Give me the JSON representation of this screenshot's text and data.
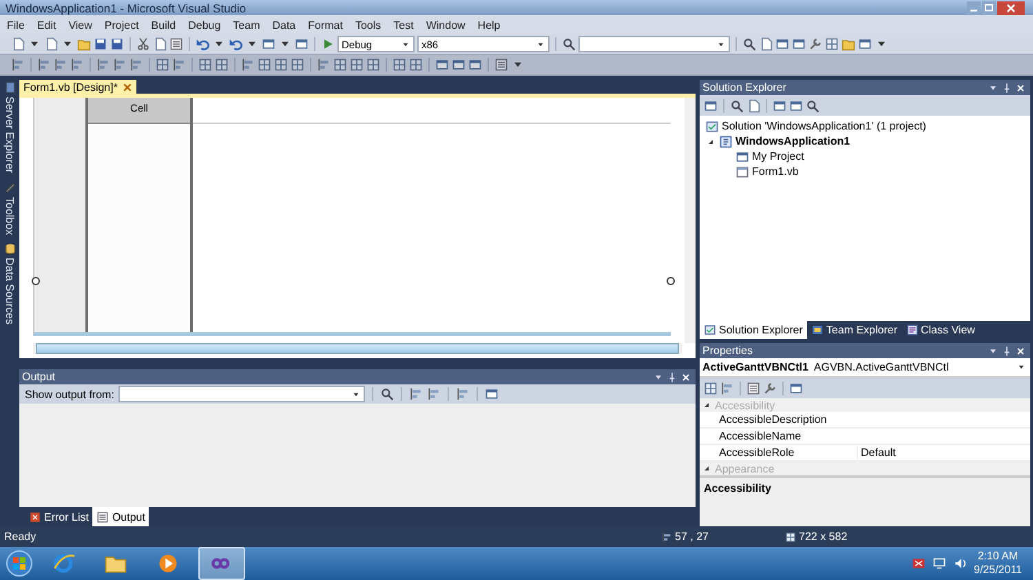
{
  "window": {
    "title": "WindowsApplication1 - Microsoft Visual Studio"
  },
  "menu": [
    "File",
    "Edit",
    "View",
    "Project",
    "Build",
    "Debug",
    "Team",
    "Data",
    "Format",
    "Tools",
    "Test",
    "Window",
    "Help"
  ],
  "toolbar": {
    "configuration": "Debug",
    "platform": "x86"
  },
  "side_tabs": [
    {
      "label": "Server Explorer",
      "kind": "server"
    },
    {
      "label": "Toolbox",
      "kind": "toolbox"
    },
    {
      "label": "Data Sources",
      "kind": "data"
    }
  ],
  "document_tabs": [
    {
      "label": "Form1.vb [Design]*",
      "selected": true
    }
  ],
  "designer": {
    "column_header": "Cell"
  },
  "solution_explorer": {
    "title": "Solution Explorer",
    "solution": "Solution 'WindowsApplication1' (1 project)",
    "projects": [
      {
        "label": "WindowsApplication1",
        "expanded": true,
        "children": [
          {
            "label": "My Project",
            "kind": "folder"
          },
          {
            "label": "Form1.vb",
            "kind": "form"
          }
        ]
      }
    ],
    "tabs": [
      {
        "label": "Solution Explorer",
        "kind": "solution",
        "selected": true
      },
      {
        "label": "Team Explorer",
        "kind": "team",
        "selected": false
      },
      {
        "label": "Class View",
        "kind": "class",
        "selected": false
      }
    ]
  },
  "properties": {
    "title": "Properties",
    "object_name": "ActiveGanttVBNCtl1",
    "object_type": "AGVBN.ActiveGanttVBNCtl",
    "categories": [
      {
        "name": "Accessibility",
        "expanded": true,
        "rows": [
          {
            "name": "AccessibleDescription"
          },
          {
            "name": "AccessibleName"
          },
          {
            "name": "AccessibleRole",
            "value": "Default"
          }
        ]
      },
      {
        "name": "Appearance",
        "expanded": true
      }
    ],
    "description_title": "Accessibility"
  },
  "output": {
    "title": "Output",
    "source_label": "Show output from:"
  },
  "bottom_tabs": [
    {
      "label": "Error List",
      "kind": "errors",
      "selected": false
    },
    {
      "label": "Output",
      "kind": "output",
      "selected": true
    }
  ],
  "status_bar": {
    "text": "Ready",
    "position": "57 , 27",
    "size": "722 x 582"
  },
  "taskbar": {
    "apps": [
      {
        "kind": "browser",
        "selected": false
      },
      {
        "kind": "folder",
        "selected": false
      },
      {
        "kind": "media",
        "selected": false
      },
      {
        "kind": "studio",
        "selected": true
      }
    ],
    "time": "2:10 AM",
    "date": "9/25/2011"
  }
}
